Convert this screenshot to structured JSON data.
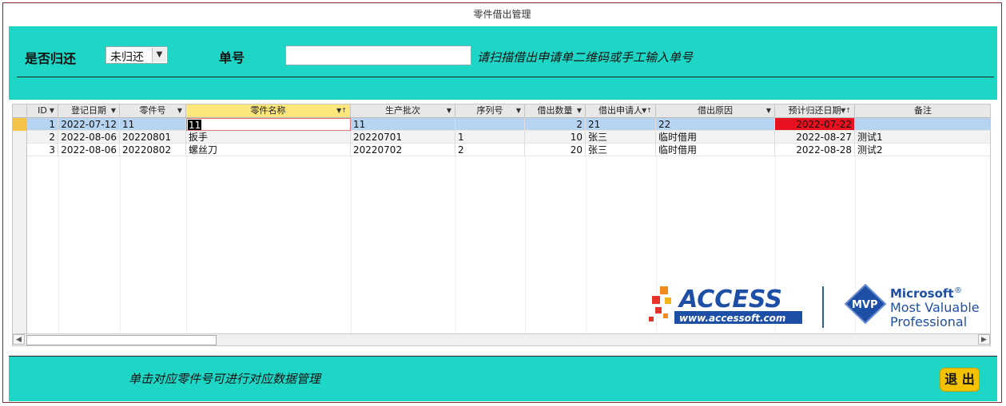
{
  "window": {
    "title": "零件借出管理"
  },
  "filter": {
    "returned_label": "是否归还",
    "returned_value": "未归还",
    "order_label": "单号",
    "order_value": "",
    "scan_hint": "请扫描借出申请单二维码或手工输入单号"
  },
  "table": {
    "columns": [
      "ID",
      "登记日期",
      "零件号",
      "零件名称",
      "生产批次",
      "序列号",
      "借出数量",
      "借出申请人",
      "借出原因",
      "预计归还日期",
      "备注"
    ],
    "rows": [
      [
        "1",
        "2022-07-12",
        "11",
        "11",
        "11",
        "",
        "2",
        "21",
        "22",
        "2022-07-22",
        ""
      ],
      [
        "2",
        "2022-08-06",
        "20220801",
        "扳手",
        "20220701",
        "1",
        "10",
        "张三",
        "临时借用",
        "2022-08-27",
        "测试1"
      ],
      [
        "3",
        "2022-08-06",
        "20220802",
        "螺丝刀",
        "20220702",
        "2",
        "20",
        "张三",
        "临时借用",
        "2022-08-28",
        "测试2"
      ]
    ]
  },
  "branding": {
    "access_logo_text": "ACCESS",
    "access_logo_url": "www.accessoft.com",
    "mvp_badge": "MVP",
    "mvp_line1": "Microsoft",
    "mvp_line2": "Most Valuable",
    "mvp_line3": "Professional"
  },
  "footer": {
    "hint": "单击对应零件号可进行对应数据管理",
    "exit_label": "退 出"
  },
  "colors": {
    "teal": "#1ed6c6",
    "selected_row": "#b6d3f2",
    "overdue": "#e8111f",
    "exit_button": "#f2c200"
  }
}
